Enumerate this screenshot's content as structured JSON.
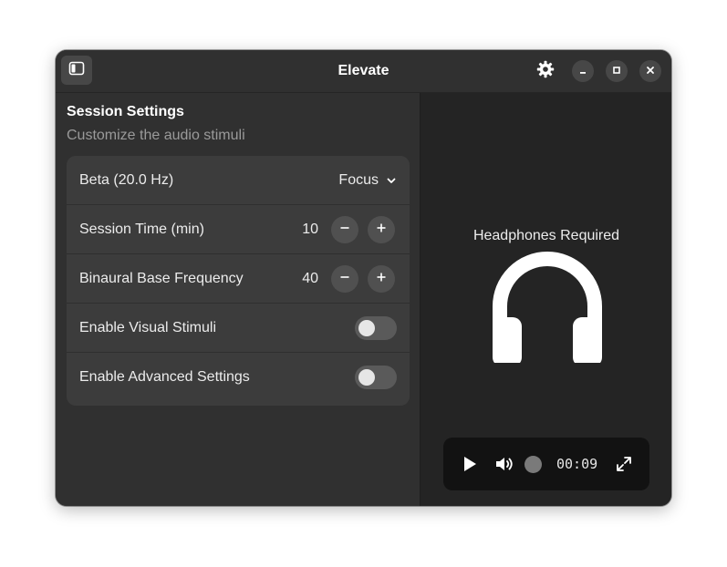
{
  "header": {
    "title": "Elevate",
    "icons": {
      "sidebar_toggle": "sidebar-toggle-icon",
      "settings": "gear-icon",
      "minimize": "minimize-icon",
      "maximize": "maximize-icon",
      "close": "close-icon"
    }
  },
  "settings": {
    "title": "Session Settings",
    "subtitle": "Customize the audio stimuli",
    "rows": [
      {
        "label": "Beta (20.0 Hz)",
        "dropdown_value": "Focus"
      },
      {
        "label": "Session Time (min)",
        "value": "10"
      },
      {
        "label": "Binaural Base Frequency",
        "value": "40"
      },
      {
        "label": "Enable Visual Stimuli",
        "enabled": false
      },
      {
        "label": "Enable Advanced Settings",
        "enabled": false
      }
    ]
  },
  "media": {
    "headphones_text": "Headphones Required",
    "time": "00:09",
    "icons": [
      "play-icon",
      "volume-icon",
      "fullscreen-icon"
    ]
  },
  "colors": {
    "window_bg": "#2e2e2e",
    "content_bg": "#242424",
    "list_bg": "#3c3c3c",
    "player_bg": "#121212"
  }
}
